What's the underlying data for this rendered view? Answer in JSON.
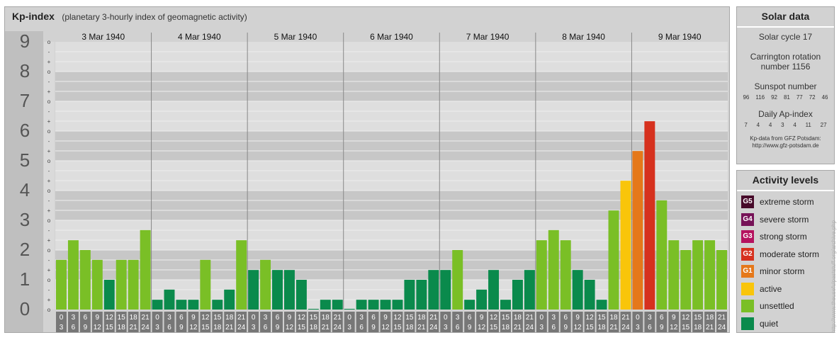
{
  "header": {
    "title": "Kp-index",
    "subtitle": "(planetary 3-hourly index of geomagnetic activity)"
  },
  "chart_data": {
    "type": "bar",
    "ylim": [
      0,
      9
    ],
    "y_ticks": [
      "0",
      "1",
      "2",
      "3",
      "4",
      "5",
      "6",
      "7",
      "8",
      "9"
    ],
    "minor_tick_labels": [
      "o",
      "+",
      "-",
      "o",
      "+",
      "-",
      "o",
      "+",
      "-",
      "o",
      "+",
      "-",
      "o",
      "+",
      "-",
      "o",
      "+",
      "-",
      "o",
      "+",
      "-",
      "o",
      "+",
      "-",
      "o",
      "+",
      "-",
      "o"
    ],
    "days": [
      "3 Mar 1940",
      "4 Mar 1940",
      "5 Mar 1940",
      "6 Mar 1940",
      "7 Mar 1940",
      "8 Mar 1940",
      "9 Mar 1940"
    ],
    "slot_start": [
      "0",
      "3",
      "6",
      "9",
      "12",
      "15",
      "18",
      "21"
    ],
    "slot_end": [
      "3",
      "6",
      "9",
      "12",
      "15",
      "18",
      "21",
      "24"
    ],
    "values": [
      1.67,
      2.33,
      2.0,
      1.67,
      1.0,
      1.67,
      1.67,
      2.67,
      0.33,
      0.67,
      0.33,
      0.33,
      1.67,
      0.33,
      0.67,
      2.33,
      1.33,
      1.67,
      1.33,
      1.33,
      1.0,
      0.0,
      0.33,
      0.33,
      0.0,
      0.33,
      0.33,
      0.33,
      0.33,
      1.0,
      1.0,
      1.33,
      1.33,
      2.0,
      0.33,
      0.67,
      1.33,
      0.33,
      1.0,
      1.33,
      2.33,
      2.67,
      2.33,
      1.33,
      1.0,
      0.33,
      3.33,
      4.33,
      5.33,
      6.33,
      3.67,
      2.33,
      2.0,
      2.33,
      2.33,
      2.0
    ],
    "colors": {
      "quiet": "#0a8a4c",
      "unsettled": "#7abf26",
      "active": "#f9c50a",
      "minor": "#e5781a",
      "moderate": "#d6311e",
      "strong": "#b5125f",
      "severe": "#761257",
      "extreme": "#470a2a"
    }
  },
  "solar": {
    "title": "Solar data",
    "cycle": "Solar cycle 17",
    "carrington_line1": "Carrington rotation",
    "carrington_line2": "number 1156",
    "sunspot_label": "Sunspot number",
    "sunspot_values": [
      "96",
      "116",
      "92",
      "81",
      "77",
      "72",
      "46"
    ],
    "ap_label": "Daily Ap-index",
    "ap_values": [
      "7",
      "4",
      "4",
      "3",
      "4",
      "11",
      "27"
    ],
    "source_line1": "Kp-data from GFZ Potsdam:",
    "source_line2": "http://www.gfz-potsdam.de"
  },
  "activity": {
    "title": "Activity levels",
    "items": [
      {
        "code": "G5",
        "label": "extreme storm",
        "color": "#470a2a"
      },
      {
        "code": "G4",
        "label": "severe storm",
        "color": "#761257"
      },
      {
        "code": "G3",
        "label": "strong storm",
        "color": "#b5125f"
      },
      {
        "code": "G2",
        "label": "moderate storm",
        "color": "#d6311e"
      },
      {
        "code": "G1",
        "label": "minor storm",
        "color": "#e5781a"
      },
      {
        "code": "",
        "label": "active",
        "color": "#f9c50a"
      },
      {
        "code": "",
        "label": "unsettled",
        "color": "#7abf26"
      },
      {
        "code": "",
        "label": "quiet",
        "color": "#0a8a4c"
      }
    ]
  },
  "credit": "http://www.theusefulpaststuff.org/archive.php"
}
